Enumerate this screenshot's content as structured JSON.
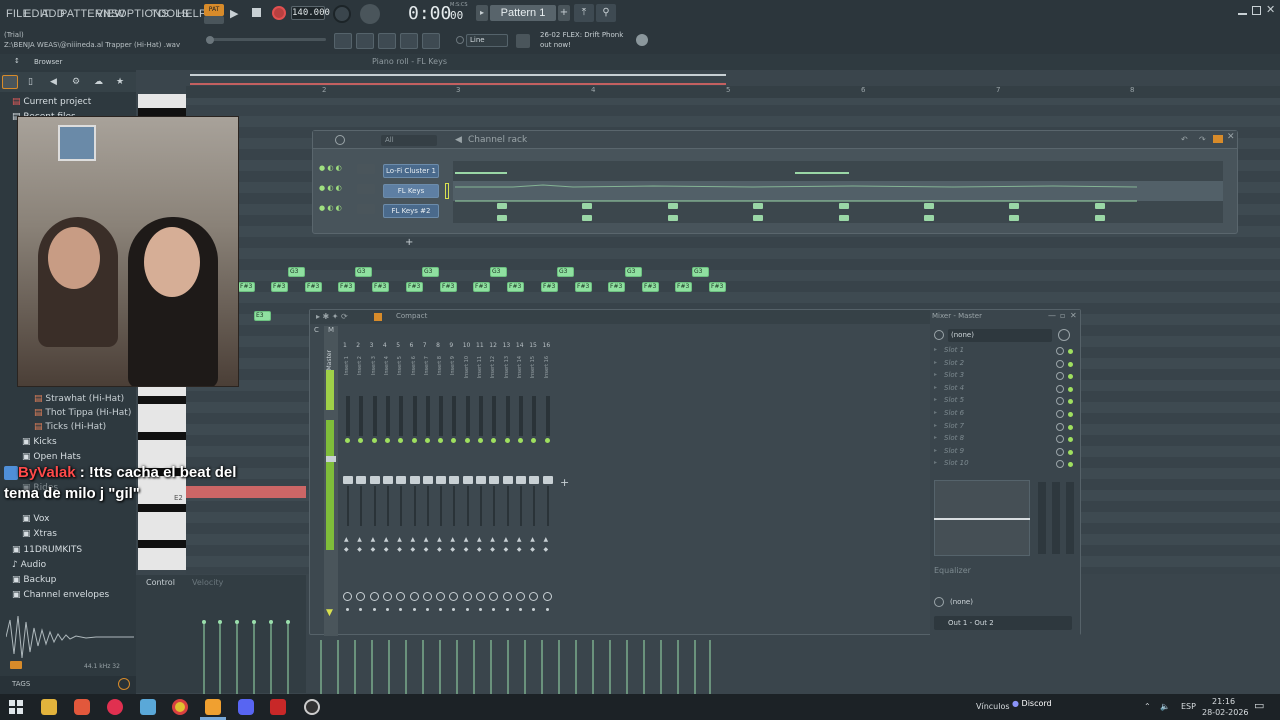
{
  "menu": {
    "file": "FILE",
    "edit": "EDIT",
    "add": "ADD",
    "patterns": "PATTERNS",
    "view": "VIEW",
    "options": "OPTIONS",
    "tools": "TOOLS",
    "help": "HELP"
  },
  "transport": {
    "pat_label": "PAT",
    "tempo": "140.000",
    "time": "0:00",
    "time_frac": "00",
    "time_unit": "M:S:CS",
    "pattern": "Pattern 1"
  },
  "hint": {
    "line1": "(Trial)",
    "line2": "Z:\\BENJA WEAS\\@niiineda.al Trapper (Hi-Hat) .wav"
  },
  "snap": "Line",
  "news": {
    "line1": "26-02 FLEX: Drift Phonk",
    "line2": "out now!"
  },
  "browser": {
    "title": "Browser",
    "items": [
      {
        "label": "Current project"
      },
      {
        "label": "Recent files"
      },
      {
        "label": "Strawhat (Hi-Hat)"
      },
      {
        "label": "Thot Tippa (Hi-Hat)"
      },
      {
        "label": "Ticks (Hi-Hat)"
      },
      {
        "label": "Kicks"
      },
      {
        "label": "Open Hats"
      },
      {
        "label": "Rides"
      },
      {
        "label": "Vox"
      },
      {
        "label": "Xtras"
      },
      {
        "label": "11DRUMKITS"
      },
      {
        "label": "Audio"
      },
      {
        "label": "Backup"
      },
      {
        "label": "Channel envelopes"
      }
    ],
    "wave_info": "44.1 kHz 32",
    "tags": "TAGS"
  },
  "pianoroll": {
    "title": "Piano roll - FL Keys",
    "ruler": [
      "2",
      "3",
      "4",
      "5",
      "6",
      "7",
      "8"
    ],
    "note_g3": "G3",
    "note_f3": "F#3",
    "note_e3": "E3",
    "note_e2": "E2",
    "control": "Control",
    "velocity": "Velocity"
  },
  "channel_rack": {
    "title": "Channel rack",
    "filter": "All",
    "channels": [
      {
        "name": "Lo-Fi Cluster 1"
      },
      {
        "name": "FL Keys"
      },
      {
        "name": "FL Keys #2"
      }
    ]
  },
  "mixer": {
    "mode": "Compact",
    "master": "Master",
    "inserts": [
      "Insert 1",
      "Insert 2",
      "Insert 3",
      "Insert 4",
      "Insert 5",
      "Insert 6",
      "Insert 7",
      "Insert 8",
      "Insert 9",
      "Insert 10",
      "Insert 11",
      "Insert 12",
      "Insert 13",
      "Insert 14",
      "Insert 15",
      "Insert 16"
    ],
    "numbers": [
      "C",
      "M",
      "1",
      "2",
      "3",
      "4",
      "5",
      "6",
      "7",
      "8",
      "9",
      "10",
      "11",
      "12",
      "13",
      "14",
      "15",
      "16"
    ],
    "panel_title": "Mixer - Master",
    "preset": "(none)",
    "slots": [
      "Slot 1",
      "Slot 2",
      "Slot 3",
      "Slot 4",
      "Slot 5",
      "Slot 6",
      "Slot 7",
      "Slot 8",
      "Slot 9",
      "Slot 10"
    ],
    "equalizer": "Equalizer",
    "output_none": "(none)",
    "output": "Out 1 - Out 2"
  },
  "chat": {
    "user": "ByValak",
    "message_a": " : !tts cacha el beat del",
    "message_b": "tema de milo j \"gil\""
  },
  "taskbar": {
    "vinculos": "Vínculos",
    "discord": "Discord",
    "lang": "ESP",
    "time": "21:16",
    "date": "28-02-2026"
  }
}
